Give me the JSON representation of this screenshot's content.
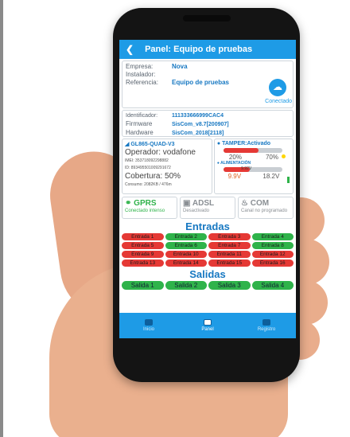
{
  "header": {
    "back_icon": "chevron-left-icon",
    "title": "Panel: Equipo de pruebas"
  },
  "info": {
    "empresa_label": "Empresa:",
    "empresa_value": "Nova",
    "instalador_label": "Instalador:",
    "instalador_value": "",
    "referencia_label": "Referencia:",
    "referencia_value": "Equipo de pruebas",
    "status_icon": "cloud-icon",
    "status_text": "Conectado",
    "identificador_label": "Identificador:",
    "identificador_value": "111333666999CAC4",
    "firmware_label": "Firmware",
    "firmware_value": "SisCom_v8.7[200907]",
    "hardware_label": "Hardware",
    "hardware_value": "SisCom_2018[2118]"
  },
  "modem": {
    "title": "GL865-QUAD-V3",
    "operador": "Operador: vodafone",
    "imei": "IMEI: 353718092298882",
    "iccid": "ID: 893495501009291672",
    "cobertura": "Cobertura: 50%",
    "consumo": "Consumo: 2082KB / 476m"
  },
  "tamper": {
    "title": "TAMPER:Activado",
    "bar1_fraction": 0.6,
    "pct_left": "20%",
    "pct_right": "70%",
    "alim_title": "ALIMENTACIÓN",
    "bar2_label": "9.92V",
    "bar2_fraction": 0.45,
    "volt_left": "9.9V",
    "volt_right": "18.2V"
  },
  "connections": [
    {
      "name": "GPRS",
      "sub": "Conectado intenso",
      "color": "#2fb34a",
      "icon": "antenna-icon"
    },
    {
      "name": "ADSL",
      "sub": "Desactivado",
      "color": "#8a8f94",
      "icon": "monitor-icon"
    },
    {
      "name": "COM",
      "sub": "Canal no programado",
      "color": "#8a8f94",
      "icon": "flame-icon"
    }
  ],
  "entradas_title": "Entradas",
  "entradas": [
    {
      "label": "Entrada 1",
      "state": "red"
    },
    {
      "label": "Entrada 2",
      "state": "green"
    },
    {
      "label": "Entrada 3",
      "state": "red"
    },
    {
      "label": "Entrada 4",
      "state": "green"
    },
    {
      "label": "Entrada 5",
      "state": "red"
    },
    {
      "label": "Entrada 6",
      "state": "green"
    },
    {
      "label": "Entrada 7",
      "state": "red"
    },
    {
      "label": "Entrada 8",
      "state": "green"
    },
    {
      "label": "Entrada 9",
      "state": "red"
    },
    {
      "label": "Entrada 10",
      "state": "red"
    },
    {
      "label": "Entrada 11",
      "state": "red"
    },
    {
      "label": "Entrada 12",
      "state": "red"
    },
    {
      "label": "Entrada 13",
      "state": "red"
    },
    {
      "label": "Entrada 14",
      "state": "red"
    },
    {
      "label": "Entrada 15",
      "state": "red"
    },
    {
      "label": "Entrada 16",
      "state": "red"
    }
  ],
  "salidas_title": "Salidas",
  "salidas": [
    "Salida 1",
    "Salida 2",
    "Salida 3",
    "Salida 4"
  ],
  "nav": [
    {
      "label": "Inicio",
      "icon": "home-icon",
      "active": false
    },
    {
      "label": "Panel",
      "icon": "panel-icon",
      "active": true
    },
    {
      "label": "Registro",
      "icon": "list-icon",
      "active": false
    }
  ],
  "colors": {
    "primary": "#1e9be6",
    "active": "#2fb34a",
    "inactive": "#e53935"
  }
}
